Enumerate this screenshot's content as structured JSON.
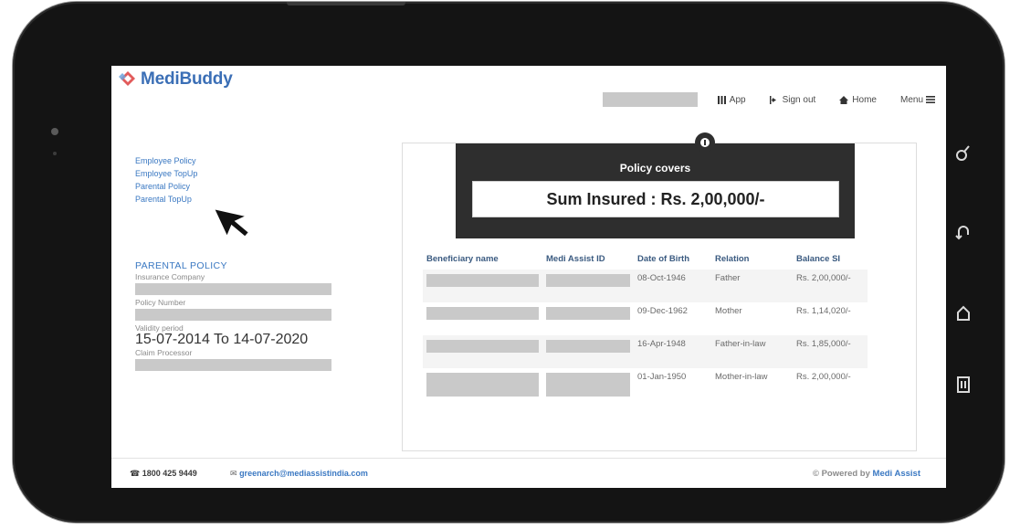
{
  "brand": {
    "name": "MediBuddy"
  },
  "topbar": {
    "items": [
      {
        "label": "App",
        "icon": "grid-icon"
      },
      {
        "label": "Sign out",
        "icon": "sign-out-icon"
      },
      {
        "label": "Home",
        "icon": "home-icon"
      },
      {
        "label": "Menu",
        "icon": "menu-icon"
      }
    ]
  },
  "sidebar": {
    "links": [
      "Employee Policy",
      "Employee TopUp",
      "Parental Policy",
      "Parental TopUp"
    ]
  },
  "parental": {
    "heading": "PARENTAL POLICY",
    "insurance_label": "Insurance Company",
    "policy_label": "Policy Number",
    "validity_label": "Validity period",
    "validity_value": "15-07-2014 To 14-07-2020",
    "claim_label": "Claim Processor"
  },
  "policy_covers": {
    "title": "Policy covers",
    "sum_insured": "Sum Insured : Rs. 2,00,000/-"
  },
  "table": {
    "headers": [
      "Beneficiary name",
      "Medi Assist ID",
      "Date of Birth",
      "Relation",
      "Balance SI"
    ],
    "rows": [
      {
        "dob": "08-Oct-1946",
        "relation": "Father",
        "balance": "Rs. 2,00,000/-"
      },
      {
        "dob": "09-Dec-1962",
        "relation": "Mother",
        "balance": "Rs. 1,14,020/-"
      },
      {
        "dob": "16-Apr-1948",
        "relation": "Father-in-law",
        "balance": "Rs. 1,85,000/-"
      },
      {
        "dob": "01-Jan-1950",
        "relation": "Mother-in-law",
        "balance": "Rs. 2,00,000/-"
      }
    ]
  },
  "footer": {
    "phone": "1800 425 9449",
    "email": "greenarch@mediassistindia.com",
    "powered_prefix": "© Powered by",
    "powered_brand": "Medi Assist"
  },
  "colors": {
    "accent": "#3a78c2",
    "dark_panel": "#2e2e2e",
    "redaction": "#c9c9c9"
  }
}
